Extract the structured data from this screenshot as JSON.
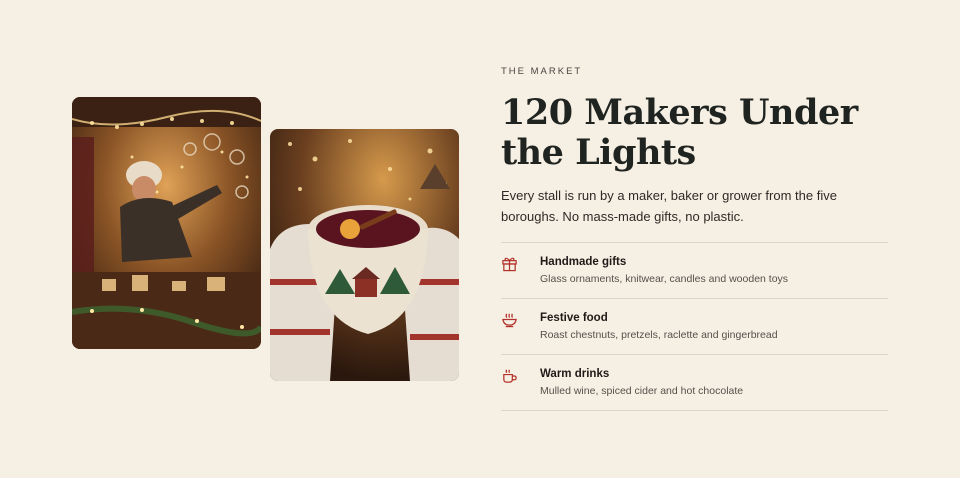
{
  "section": {
    "eyebrow": "THE MARKET",
    "title": "120 Makers Under the Lights",
    "description": "Every stall is run by a maker, baker or grower from the five boroughs. No mass-made gifts, no plastic.",
    "accent_color": "#b3312a"
  },
  "images": [
    {
      "alt": "Vendor arranging glass ornaments at a lit market stall"
    },
    {
      "alt": "Hands in knit mittens holding a mug of mulled wine"
    }
  ],
  "features": [
    {
      "icon": "gift-icon",
      "title": "Handmade gifts",
      "description": "Glass ornaments, knitwear, candles and wooden toys"
    },
    {
      "icon": "food-bowl-icon",
      "title": "Festive food",
      "description": "Roast chestnuts, pretzels, raclette and gingerbread"
    },
    {
      "icon": "mug-icon",
      "title": "Warm drinks",
      "description": "Mulled wine, spiced cider and hot chocolate"
    }
  ]
}
